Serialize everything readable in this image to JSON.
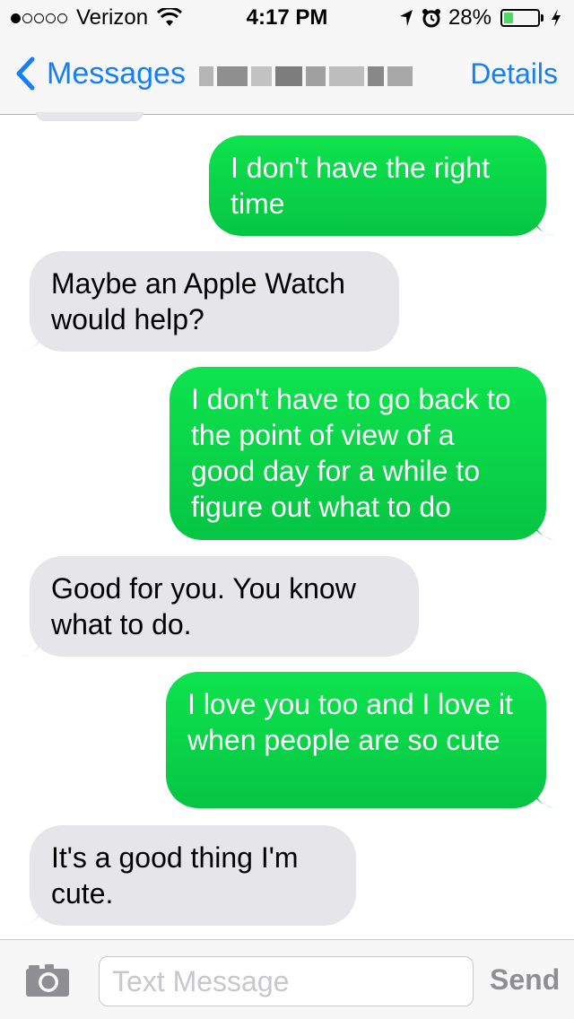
{
  "status_bar": {
    "signal_dots": [
      true,
      false,
      false,
      false,
      false
    ],
    "carrier": "Verizon",
    "time": "4:17 PM",
    "battery_percent": "28%",
    "battery_level": 0.28,
    "icons": [
      "wifi-icon",
      "location-icon",
      "alarm-icon",
      "battery-icon",
      "charging-bolt-icon"
    ]
  },
  "nav": {
    "back_label": "Messages",
    "details_label": "Details"
  },
  "messages": [
    {
      "direction": "outgoing",
      "text": "I don't have the right time"
    },
    {
      "direction": "incoming",
      "text": "Maybe an Apple Watch would help?"
    },
    {
      "direction": "outgoing",
      "text": "I don't have to go back to the point of view of a good day for a while to figure out what to do"
    },
    {
      "direction": "incoming",
      "text": "Good for you.  You know what to do."
    },
    {
      "direction": "outgoing",
      "text": "I love you too and I love it when people are so cute"
    },
    {
      "direction": "incoming",
      "text": "It's a good thing I'm cute."
    }
  ],
  "composer": {
    "placeholder": "Text Message",
    "send_label": "Send"
  },
  "colors": {
    "accent_blue": "#157efb",
    "outgoing_green": "#0ee34d",
    "incoming_gray": "#e5e5ea"
  }
}
